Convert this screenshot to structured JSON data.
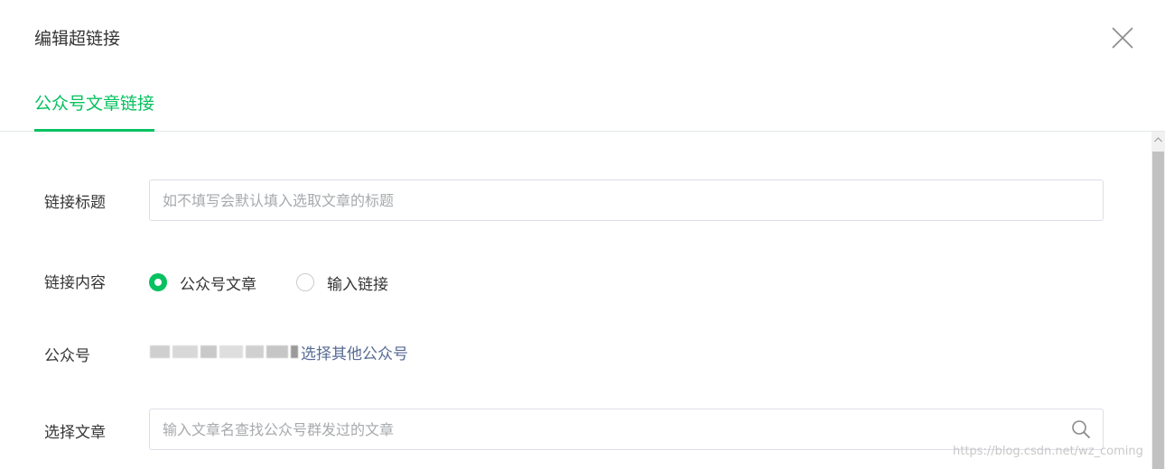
{
  "dialog": {
    "title": "编辑超链接"
  },
  "tabs": [
    {
      "label": "公众号文章链接",
      "active": true
    }
  ],
  "form": {
    "title_field": {
      "label": "链接标题",
      "placeholder": "如不填写会默认填入选取文章的标题",
      "value": ""
    },
    "content_field": {
      "label": "链接内容",
      "options": [
        {
          "label": "公众号文章",
          "checked": true
        },
        {
          "label": "输入链接",
          "checked": false
        }
      ]
    },
    "account_field": {
      "label": "公众号",
      "link_text": "选择其他公众号"
    },
    "article_field": {
      "label": "选择文章",
      "placeholder": "输入文章名查找公众号群发过的文章",
      "value": ""
    }
  },
  "watermark": "https://blog.csdn.net/wz_coming",
  "colors": {
    "accent": "#07c160",
    "link": "#576b95",
    "text": "#353535",
    "placeholder": "#a7aaad",
    "border": "#dcdfe6"
  },
  "icons": {
    "close": "close-icon",
    "search": "search-icon",
    "scroll_up": "chevron-up-icon"
  }
}
